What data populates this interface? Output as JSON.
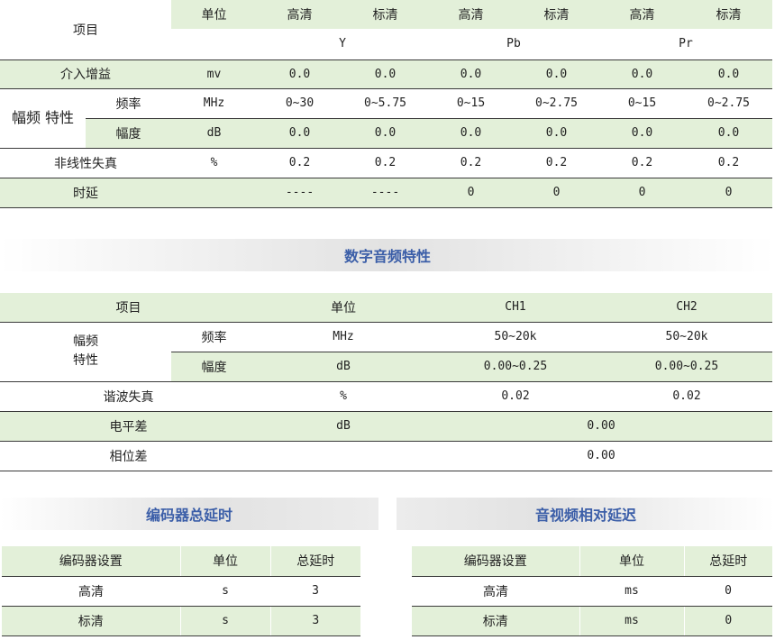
{
  "video_table": {
    "item_header": "项目",
    "unit_header": "单位",
    "quality_headers": [
      "高清",
      "标清",
      "高清",
      "标清",
      "高清",
      "标清"
    ],
    "components": [
      "Y",
      "Pb",
      "Pr"
    ],
    "rows": {
      "insertion_gain": {
        "label": "介入增益",
        "unit": "mv",
        "values": [
          "0.0",
          "0.0",
          "0.0",
          "0.0",
          "0.0",
          "0.0"
        ]
      },
      "amp_freq_group": "幅频\n特性",
      "frequency": {
        "label": "频率",
        "unit": "MHz",
        "values": [
          "0~30",
          "0~5.75",
          "0~15",
          "0~2.75",
          "0~15",
          "0~2.75"
        ]
      },
      "amplitude": {
        "label": "幅度",
        "unit": "dB",
        "values": [
          "0.0",
          "0.0",
          "0.0",
          "0.0",
          "0.0",
          "0.0"
        ]
      },
      "nonlinear_distortion": {
        "label": "非线性失真",
        "unit": "%",
        "values": [
          "0.2",
          "0.2",
          "0.2",
          "0.2",
          "0.2",
          "0.2"
        ]
      },
      "delay": {
        "label": "时延",
        "unit": "",
        "values": [
          "----",
          "----",
          "0",
          "0",
          "0",
          "0"
        ]
      }
    }
  },
  "audio_section_title": "数字音频特性",
  "audio_table": {
    "item_header": "项目",
    "unit_header": "单位",
    "channels": [
      "CH1",
      "CH2"
    ],
    "amp_freq_group": "幅频\n特性",
    "frequency": {
      "label": "频率",
      "unit": "MHz",
      "values": [
        "50~20k",
        "50~20k"
      ]
    },
    "amplitude": {
      "label": "幅度",
      "unit": "dB",
      "values": [
        "0.00~0.25",
        "0.00~0.25"
      ]
    },
    "harmonic_distortion": {
      "label": "谐波失真",
      "unit": "%",
      "values": [
        "0.02",
        "0.02"
      ]
    },
    "level_diff": {
      "label": "电平差",
      "unit": "dB",
      "value": "0.00"
    },
    "phase_diff": {
      "label": "相位差",
      "unit": "",
      "value": "0.00"
    }
  },
  "encoder_delay": {
    "title": "编码器总延时",
    "headers": [
      "编码器设置",
      "单位",
      "总延时"
    ],
    "rows": [
      [
        "高清",
        "s",
        "3"
      ],
      [
        "标清",
        "s",
        "3"
      ]
    ]
  },
  "av_delay": {
    "title": "音视频相对延迟",
    "headers": [
      "编码器设置",
      "单位",
      "总延时"
    ],
    "rows": [
      [
        "高清",
        "ms",
        "0"
      ],
      [
        "标清",
        "ms",
        "0"
      ]
    ]
  },
  "colors": {
    "row_green": "#e3f0d9",
    "title_blue": "#3b5ea8",
    "rule": "#3a3a3a"
  }
}
